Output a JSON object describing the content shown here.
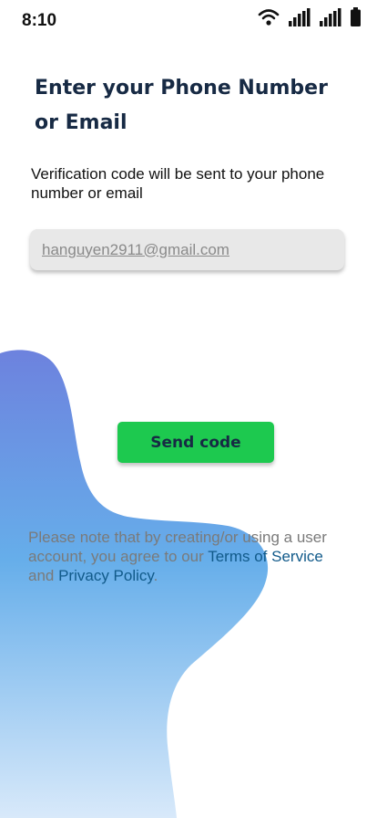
{
  "status_bar": {
    "time": "8:10",
    "icons": [
      "wifi-icon",
      "signal-icon",
      "signal-icon-secondary",
      "battery-icon"
    ]
  },
  "heading": "Enter your Phone Number or Email",
  "subtitle": "Verification code will be sent to your phone number or email",
  "contact_input": {
    "value": "hanguyen2911@gmail.com",
    "placeholder": ""
  },
  "send_button": {
    "label": "Send code"
  },
  "terms": {
    "prefix": "Please note that by creating/or using a user account, you agree to our ",
    "terms_link": "Terms of Service",
    "middle": " and ",
    "privacy_link": "Privacy Policy",
    "suffix": "."
  },
  "colors": {
    "heading": "#172a44",
    "button": "#1dc94f",
    "link": "#115a8a",
    "blob_top": "#6d82de",
    "blob_mid": "#66aeea",
    "blob_bottom": "#d8e9fa"
  }
}
